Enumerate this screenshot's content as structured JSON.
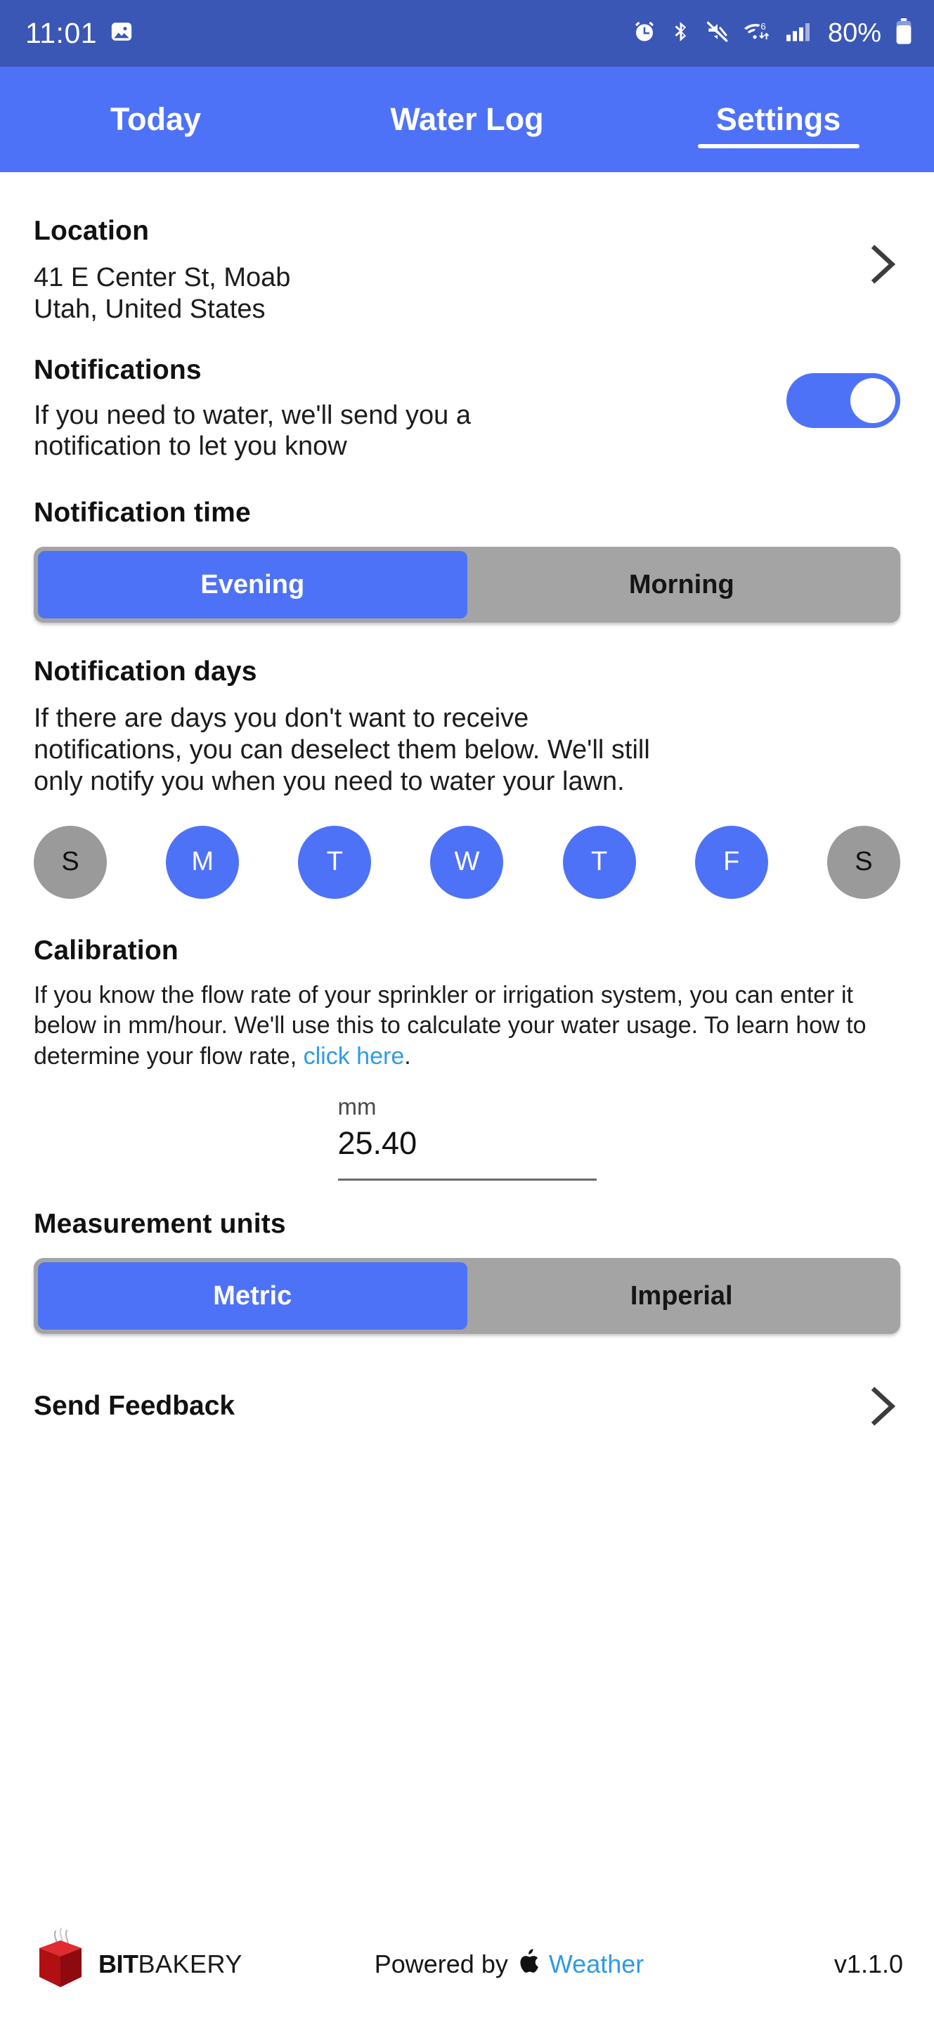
{
  "status_bar": {
    "time": "11:01",
    "battery_percent": "80%",
    "icons": [
      "screenshot-icon",
      "alarm-icon",
      "bluetooth-icon",
      "mute-icon",
      "wifi-6-icon",
      "cellular-signal-icon",
      "battery-icon"
    ],
    "background_color": "#3a57b5"
  },
  "tabs": {
    "items": [
      {
        "label": "Today",
        "active": false
      },
      {
        "label": "Water Log",
        "active": false
      },
      {
        "label": "Settings",
        "active": true
      }
    ],
    "background_color": "#4e72f7"
  },
  "location": {
    "title": "Location",
    "line1": "41 E Center St, Moab",
    "line2": "Utah, United States",
    "chevron": "chevron-right-icon"
  },
  "notifications": {
    "title": "Notifications",
    "description_line1": "If you need to water, we'll send you a",
    "description_line2": "notification to let you know",
    "toggle_on": true
  },
  "notification_time": {
    "title": "Notification time",
    "options": [
      "Evening",
      "Morning"
    ],
    "selected": "Evening"
  },
  "notification_days": {
    "title": "Notification days",
    "description_line1": "If there are days you don't want to receive",
    "description_line2": "notifications, you can deselect them below. We'll still",
    "description_line3": "only notify you when you need to water your lawn.",
    "days": [
      {
        "label": "S",
        "selected": false
      },
      {
        "label": "M",
        "selected": true
      },
      {
        "label": "T",
        "selected": true
      },
      {
        "label": "W",
        "selected": true
      },
      {
        "label": "T",
        "selected": true
      },
      {
        "label": "F",
        "selected": true
      },
      {
        "label": "S",
        "selected": false
      }
    ]
  },
  "calibration": {
    "title": "Calibration",
    "desc_part1": "If you know the flow rate of your sprinkler or irrigation system, you can enter it below in mm/hour. We'll use this to calculate your water usage. To learn how to determine your flow rate, ",
    "link_text": "click here",
    "desc_part2": ".",
    "unit_label": "mm",
    "value": "25.40"
  },
  "measurement_units": {
    "title": "Measurement units",
    "options": [
      "Metric",
      "Imperial"
    ],
    "selected": "Metric"
  },
  "feedback": {
    "label": "Send Feedback",
    "chevron": "chevron-right-icon"
  },
  "footer": {
    "brand_bold": "BIT",
    "brand_light": "BAKERY",
    "powered_by": "Powered by",
    "weather_source": "Weather",
    "version": "v1.1.0"
  },
  "colors": {
    "accent_blue": "#4e72f7",
    "status_bar_blue": "#3a57b5",
    "link_blue": "#2f9be3",
    "segment_track_gray": "#a4a4a4",
    "day_off_gray": "#9a9a9a",
    "brand_red": "#c9151b"
  }
}
